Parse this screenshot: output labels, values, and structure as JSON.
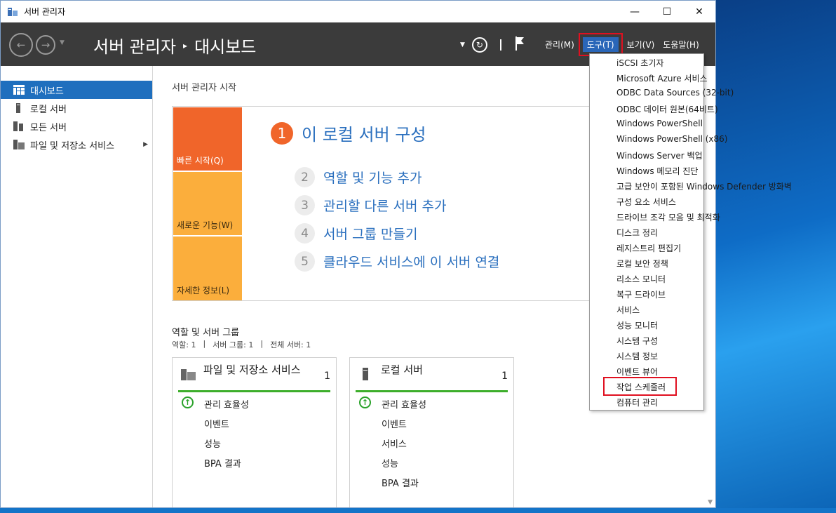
{
  "window": {
    "title": "서버 관리자"
  },
  "header": {
    "breadcrumb": [
      "서버 관리자",
      "대시보드"
    ],
    "separator": "▸",
    "menus": [
      {
        "label": "관리(M)",
        "active": false
      },
      {
        "label": "도구(T)",
        "active": true
      },
      {
        "label": "보기(V)",
        "active": false
      },
      {
        "label": "도움말(H)",
        "active": false
      }
    ]
  },
  "sidebar": {
    "items": [
      {
        "label": "대시보드",
        "icon": "dashboard-icon"
      },
      {
        "label": "로컬 서버",
        "icon": "server-icon"
      },
      {
        "label": "모든 서버",
        "icon": "servers-icon"
      },
      {
        "label": "파일 및 저장소 서비스",
        "icon": "storage-icon"
      }
    ]
  },
  "main": {
    "section_title": "서버 관리자 시작",
    "tiles": [
      "빠른 시작(Q)",
      "새로운 기능(W)",
      "자세한 정보(L)"
    ],
    "main_step": {
      "num": "1",
      "text": "이 로컬 서버 구성"
    },
    "steps": [
      {
        "num": "2",
        "text": "역할 및 기능 추가"
      },
      {
        "num": "3",
        "text": "관리할 다른 서버 추가"
      },
      {
        "num": "4",
        "text": "서버 그룹 만들기"
      },
      {
        "num": "5",
        "text": "클라우드 서비스에 이 서버 연결"
      }
    ],
    "roles_title": "역할 및 서버 그룹",
    "roles_stats": [
      "역할: 1",
      "|",
      "서버 그룹: 1",
      "|",
      "전체 서버: 1"
    ],
    "cards": [
      {
        "title": "파일 및 저장소 서비스",
        "count": "1",
        "rows": [
          "관리 효율성",
          "이벤트",
          "성능",
          "BPA 결과"
        ]
      },
      {
        "title": "로컬 서버",
        "count": "1",
        "rows": [
          "관리 효율성",
          "이벤트",
          "서비스",
          "성능",
          "BPA 결과"
        ]
      }
    ]
  },
  "tools_menu": {
    "items": [
      "iSCSI 초기자",
      "Microsoft Azure 서비스",
      "ODBC Data Sources (32-bit)",
      "ODBC 데이터 원본(64비트)",
      "Windows PowerShell",
      "Windows PowerShell (x86)",
      "Windows Server 백업",
      "Windows 메모리 진단",
      "고급 보안이 포함된 Windows Defender 방화벽",
      "구성 요소 서비스",
      "드라이브 조각 모음 및 최적화",
      "디스크 정리",
      "레지스트리 편집기",
      "로컬 보안 정책",
      "리소스 모니터",
      "복구 드라이브",
      "서비스",
      "성능 모니터",
      "시스템 구성",
      "시스템 정보",
      "이벤트 뷰어",
      "작업 스케줄러",
      "컴퓨터 관리"
    ],
    "highlighted": "작업 스케줄러"
  },
  "colors": {
    "accent": "#1f6fbe",
    "orange": "#f0652a",
    "amber": "#fbae3c",
    "highlight_box": "#e01020",
    "header_bg": "#3b3b3b"
  }
}
